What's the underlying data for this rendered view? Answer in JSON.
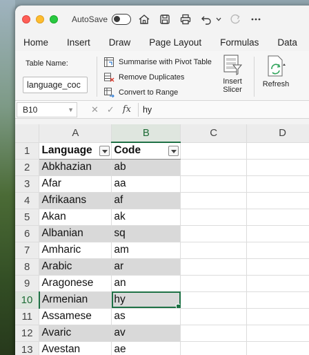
{
  "titlebar": {
    "autosave_label": "AutoSave"
  },
  "menu": [
    "Home",
    "Insert",
    "Draw",
    "Page Layout",
    "Formulas",
    "Data"
  ],
  "ribbon": {
    "table_name_label": "Table Name:",
    "table_name_value": "language_coc",
    "summarise": "Summarise with Pivot Table",
    "remove_duplicates": "Remove Duplicates",
    "convert_to_range": "Convert to Range",
    "insert_slicer_line1": "Insert",
    "insert_slicer_line2": "Slicer",
    "refresh": "Refresh"
  },
  "formula_bar": {
    "cell_ref": "B10",
    "fx": "fx",
    "value": "hy"
  },
  "columns": [
    "A",
    "B",
    "C",
    "D"
  ],
  "header_row": {
    "row": "1",
    "language": "Language",
    "code": "Code"
  },
  "rows": [
    {
      "n": "2",
      "language": "Abkhazian",
      "code": "ab"
    },
    {
      "n": "3",
      "language": "Afar",
      "code": "aa"
    },
    {
      "n": "4",
      "language": "Afrikaans",
      "code": "af"
    },
    {
      "n": "5",
      "language": "Akan",
      "code": "ak"
    },
    {
      "n": "6",
      "language": "Albanian",
      "code": "sq"
    },
    {
      "n": "7",
      "language": "Amharic",
      "code": "am"
    },
    {
      "n": "8",
      "language": "Arabic",
      "code": "ar"
    },
    {
      "n": "9",
      "language": "Aragonese",
      "code": "an"
    },
    {
      "n": "10",
      "language": "Armenian",
      "code": "hy"
    },
    {
      "n": "11",
      "language": "Assamese",
      "code": "as"
    },
    {
      "n": "12",
      "language": "Avaric",
      "code": "av"
    },
    {
      "n": "13",
      "language": "Avestan",
      "code": "ae"
    }
  ],
  "selection": {
    "column": "B",
    "row": "10"
  },
  "colors": {
    "accent_green": "#1e7145",
    "band_gray": "#d9d9d9"
  }
}
